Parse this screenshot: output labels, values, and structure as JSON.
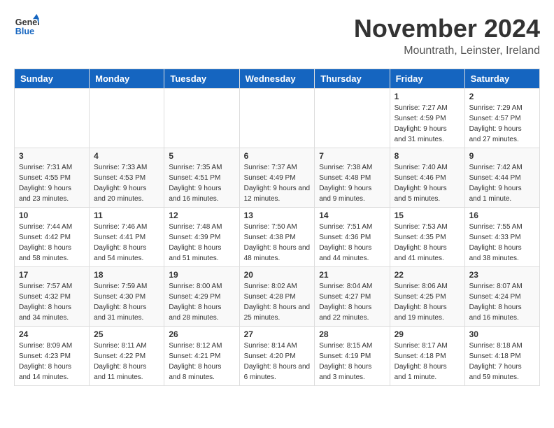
{
  "logo": {
    "line1": "General",
    "line2": "Blue"
  },
  "title": "November 2024",
  "location": "Mountrath, Leinster, Ireland",
  "headers": [
    "Sunday",
    "Monday",
    "Tuesday",
    "Wednesday",
    "Thursday",
    "Friday",
    "Saturday"
  ],
  "weeks": [
    [
      {
        "day": "",
        "info": ""
      },
      {
        "day": "",
        "info": ""
      },
      {
        "day": "",
        "info": ""
      },
      {
        "day": "",
        "info": ""
      },
      {
        "day": "",
        "info": ""
      },
      {
        "day": "1",
        "info": "Sunrise: 7:27 AM\nSunset: 4:59 PM\nDaylight: 9 hours and 31 minutes."
      },
      {
        "day": "2",
        "info": "Sunrise: 7:29 AM\nSunset: 4:57 PM\nDaylight: 9 hours and 27 minutes."
      }
    ],
    [
      {
        "day": "3",
        "info": "Sunrise: 7:31 AM\nSunset: 4:55 PM\nDaylight: 9 hours and 23 minutes."
      },
      {
        "day": "4",
        "info": "Sunrise: 7:33 AM\nSunset: 4:53 PM\nDaylight: 9 hours and 20 minutes."
      },
      {
        "day": "5",
        "info": "Sunrise: 7:35 AM\nSunset: 4:51 PM\nDaylight: 9 hours and 16 minutes."
      },
      {
        "day": "6",
        "info": "Sunrise: 7:37 AM\nSunset: 4:49 PM\nDaylight: 9 hours and 12 minutes."
      },
      {
        "day": "7",
        "info": "Sunrise: 7:38 AM\nSunset: 4:48 PM\nDaylight: 9 hours and 9 minutes."
      },
      {
        "day": "8",
        "info": "Sunrise: 7:40 AM\nSunset: 4:46 PM\nDaylight: 9 hours and 5 minutes."
      },
      {
        "day": "9",
        "info": "Sunrise: 7:42 AM\nSunset: 4:44 PM\nDaylight: 9 hours and 1 minute."
      }
    ],
    [
      {
        "day": "10",
        "info": "Sunrise: 7:44 AM\nSunset: 4:42 PM\nDaylight: 8 hours and 58 minutes."
      },
      {
        "day": "11",
        "info": "Sunrise: 7:46 AM\nSunset: 4:41 PM\nDaylight: 8 hours and 54 minutes."
      },
      {
        "day": "12",
        "info": "Sunrise: 7:48 AM\nSunset: 4:39 PM\nDaylight: 8 hours and 51 minutes."
      },
      {
        "day": "13",
        "info": "Sunrise: 7:50 AM\nSunset: 4:38 PM\nDaylight: 8 hours and 48 minutes."
      },
      {
        "day": "14",
        "info": "Sunrise: 7:51 AM\nSunset: 4:36 PM\nDaylight: 8 hours and 44 minutes."
      },
      {
        "day": "15",
        "info": "Sunrise: 7:53 AM\nSunset: 4:35 PM\nDaylight: 8 hours and 41 minutes."
      },
      {
        "day": "16",
        "info": "Sunrise: 7:55 AM\nSunset: 4:33 PM\nDaylight: 8 hours and 38 minutes."
      }
    ],
    [
      {
        "day": "17",
        "info": "Sunrise: 7:57 AM\nSunset: 4:32 PM\nDaylight: 8 hours and 34 minutes."
      },
      {
        "day": "18",
        "info": "Sunrise: 7:59 AM\nSunset: 4:30 PM\nDaylight: 8 hours and 31 minutes."
      },
      {
        "day": "19",
        "info": "Sunrise: 8:00 AM\nSunset: 4:29 PM\nDaylight: 8 hours and 28 minutes."
      },
      {
        "day": "20",
        "info": "Sunrise: 8:02 AM\nSunset: 4:28 PM\nDaylight: 8 hours and 25 minutes."
      },
      {
        "day": "21",
        "info": "Sunrise: 8:04 AM\nSunset: 4:27 PM\nDaylight: 8 hours and 22 minutes."
      },
      {
        "day": "22",
        "info": "Sunrise: 8:06 AM\nSunset: 4:25 PM\nDaylight: 8 hours and 19 minutes."
      },
      {
        "day": "23",
        "info": "Sunrise: 8:07 AM\nSunset: 4:24 PM\nDaylight: 8 hours and 16 minutes."
      }
    ],
    [
      {
        "day": "24",
        "info": "Sunrise: 8:09 AM\nSunset: 4:23 PM\nDaylight: 8 hours and 14 minutes."
      },
      {
        "day": "25",
        "info": "Sunrise: 8:11 AM\nSunset: 4:22 PM\nDaylight: 8 hours and 11 minutes."
      },
      {
        "day": "26",
        "info": "Sunrise: 8:12 AM\nSunset: 4:21 PM\nDaylight: 8 hours and 8 minutes."
      },
      {
        "day": "27",
        "info": "Sunrise: 8:14 AM\nSunset: 4:20 PM\nDaylight: 8 hours and 6 minutes."
      },
      {
        "day": "28",
        "info": "Sunrise: 8:15 AM\nSunset: 4:19 PM\nDaylight: 8 hours and 3 minutes."
      },
      {
        "day": "29",
        "info": "Sunrise: 8:17 AM\nSunset: 4:18 PM\nDaylight: 8 hours and 1 minute."
      },
      {
        "day": "30",
        "info": "Sunrise: 8:18 AM\nSunset: 4:18 PM\nDaylight: 7 hours and 59 minutes."
      }
    ]
  ]
}
